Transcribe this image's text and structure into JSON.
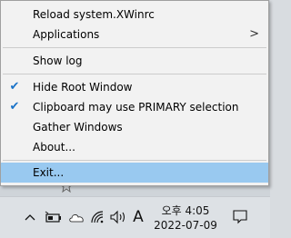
{
  "menu": {
    "items": [
      {
        "label": "Reload system.XWinrc",
        "checked": false,
        "submenu": false
      },
      {
        "label": "Applications",
        "checked": false,
        "submenu": true
      },
      {
        "label": "Show log",
        "checked": false,
        "submenu": false
      },
      {
        "label": "Hide Root Window",
        "checked": true,
        "submenu": false
      },
      {
        "label": "Clipboard may use PRIMARY selection",
        "checked": true,
        "submenu": false
      },
      {
        "label": "Gather Windows",
        "checked": false,
        "submenu": false
      },
      {
        "label": "About...",
        "checked": false,
        "submenu": false
      },
      {
        "label": "Exit...",
        "checked": false,
        "submenu": false,
        "highlighted": true
      }
    ],
    "submenu_arrow": ">",
    "check_glyph": "✔"
  },
  "taskbar": {
    "ime_indicator": "A",
    "clock_time": "오후 4:05",
    "clock_date": "2022-07-09"
  },
  "colors": {
    "menu_bg": "#f2f2f2",
    "highlight": "#99c9f0",
    "check": "#1a73c8",
    "taskbar_bg": "#dde1e5"
  }
}
